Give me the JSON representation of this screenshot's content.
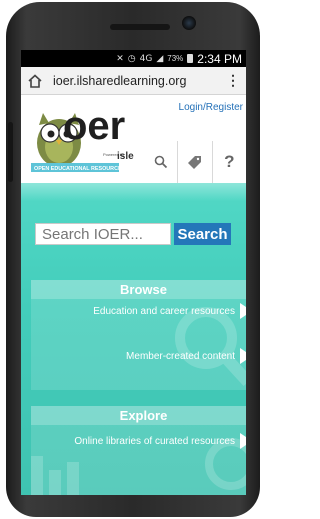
{
  "status_bar": {
    "battery_percent": "73%",
    "time": "2:34 PM",
    "icons": [
      "mute-icon",
      "alarm-icon",
      "4g-icon",
      "signal-icon",
      "battery-icon"
    ]
  },
  "browser": {
    "url": "ioer.ilsharedlearning.org",
    "menu_glyph": "⋮"
  },
  "header": {
    "logo_text": "oer",
    "logo_powered_by": "Powered by",
    "logo_brand": "isle",
    "logo_tagline": "OPEN EDUCATIONAL RESOURCES",
    "login_label": "Login/Register",
    "help_label": "?"
  },
  "search": {
    "placeholder": "Search IOER...",
    "button_label": "Search"
  },
  "browse": {
    "title": "Browse",
    "links": [
      "Education and career resources",
      "Member-created content"
    ]
  },
  "explore": {
    "title": "Explore",
    "links": [
      "Online libraries of curated resources"
    ]
  },
  "colors": {
    "teal": "#46d0be",
    "search_button": "#2477b9",
    "login_link": "#2471b8",
    "logo_tagline_bg": "#5ec4d8"
  }
}
